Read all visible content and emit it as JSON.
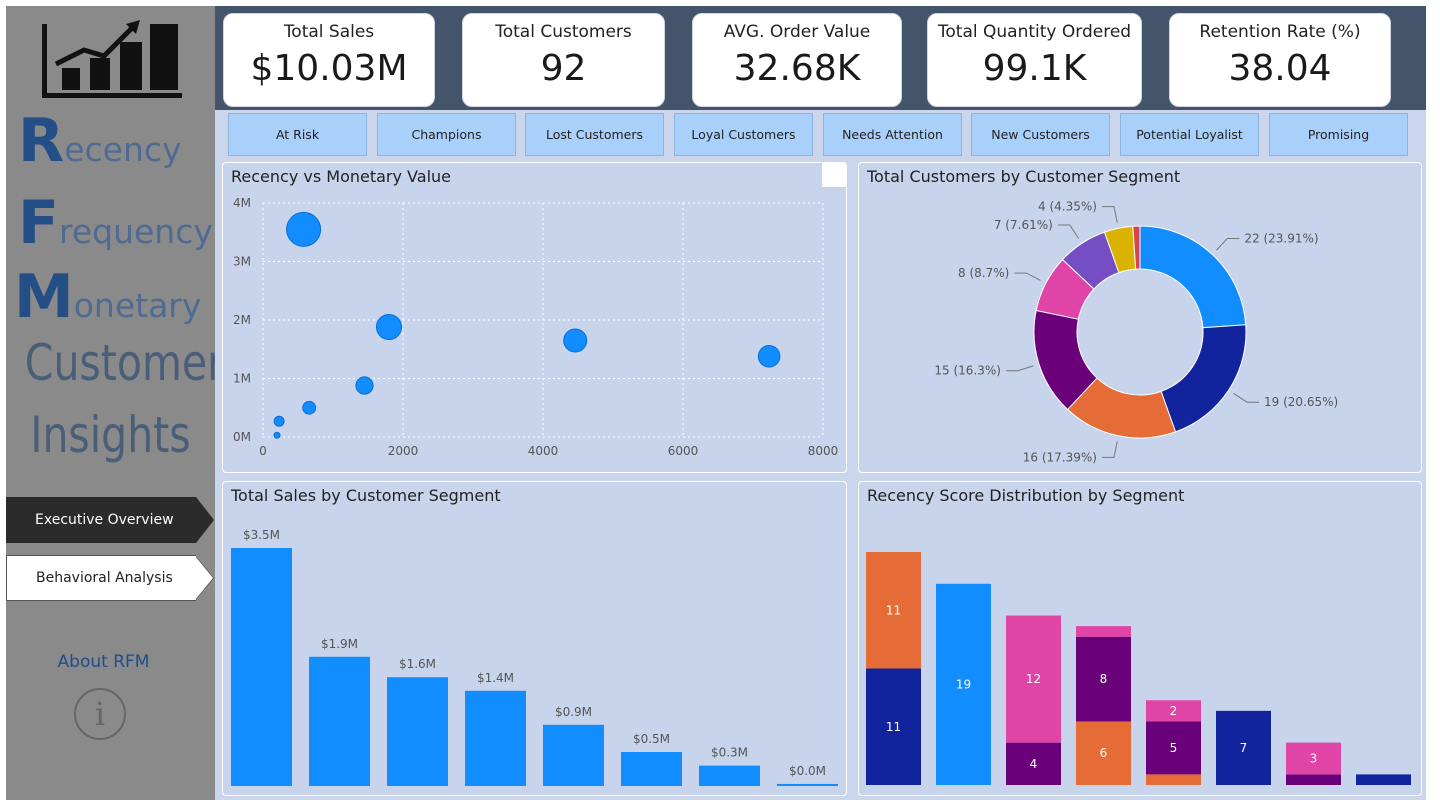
{
  "sidebar": {
    "rfm": [
      {
        "initial": "R",
        "rest": "ecency"
      },
      {
        "initial": "F",
        "rest": "requency"
      },
      {
        "initial": "M",
        "rest": "onetary"
      }
    ],
    "customer_text": "Customer",
    "insights_text": "Insights",
    "nav": [
      {
        "label": "Executive Overview",
        "active": true
      },
      {
        "label": "Behavioral Analysis",
        "active": false
      }
    ],
    "about_label": "About RFM",
    "about_icon": "i"
  },
  "kpis": [
    {
      "label": "Total Sales",
      "value": "$10.03M"
    },
    {
      "label": "Total Customers",
      "value": "92"
    },
    {
      "label": "AVG. Order Value",
      "value": "32.68K"
    },
    {
      "label": "Total Quantity Ordered",
      "value": "99.1K"
    },
    {
      "label": "Retention Rate (%)",
      "value": "38.04"
    }
  ],
  "segment_buttons": [
    "At Risk",
    "Champions",
    "Lost Customers",
    "Loyal Customers",
    "Needs Attention",
    "New Customers",
    "Potential Loyalist",
    "Promising"
  ],
  "panels": {
    "scatter_title": "Recency vs Monetary Value",
    "donut_title": "Total Customers by Customer Segment",
    "bar_title": "Total Sales by Customer Segment",
    "stack_title": "Recency Score Distribution by Segment"
  },
  "colors": {
    "bright_blue": "#118dff",
    "navy": "#12239e",
    "orange": "#e66c37",
    "dark_purple": "#6b007b",
    "pink": "#e044a7",
    "violet": "#744ec2",
    "gold": "#d9b300",
    "red": "#d64550"
  },
  "chart_data": [
    {
      "type": "scatter",
      "title": "Recency vs Monetary Value",
      "xlim": [
        0,
        8000
      ],
      "ylim": [
        0,
        4000000
      ],
      "x_ticks": [
        "0",
        "2000",
        "4000",
        "6000",
        "8000"
      ],
      "y_ticks": [
        "0M",
        "1M",
        "2M",
        "3M",
        "4M"
      ],
      "points": [
        {
          "x": 580,
          "y": 3550000,
          "size": 3.5
        },
        {
          "x": 1800,
          "y": 1880000,
          "size": 1.9
        },
        {
          "x": 4460,
          "y": 1650000,
          "size": 1.6
        },
        {
          "x": 7230,
          "y": 1380000,
          "size": 1.4
        },
        {
          "x": 1450,
          "y": 880000,
          "size": 0.9
        },
        {
          "x": 660,
          "y": 500000,
          "size": 0.5
        },
        {
          "x": 230,
          "y": 270000,
          "size": 0.3
        },
        {
          "x": 200,
          "y": 30000,
          "size": 0.03
        }
      ]
    },
    {
      "type": "pie",
      "title": "Total Customers by Customer Segment",
      "slices": [
        {
          "value": 22,
          "label": "22 (23.91%)",
          "color": "#118dff"
        },
        {
          "value": 19,
          "label": "19 (20.65%)",
          "color": "#12239e"
        },
        {
          "value": 16,
          "label": "16 (17.39%)",
          "color": "#e66c37"
        },
        {
          "value": 15,
          "label": "15 (16.3%)",
          "color": "#6b007b"
        },
        {
          "value": 8,
          "label": "8 (8.7%)",
          "color": "#e044a7"
        },
        {
          "value": 7,
          "label": "7 (7.61%)",
          "color": "#744ec2"
        },
        {
          "value": 4,
          "label": "4 (4.35%)",
          "color": "#d9b300"
        },
        {
          "value": 1,
          "label": "",
          "color": "#d64550"
        }
      ]
    },
    {
      "type": "bar",
      "title": "Total Sales by Customer Segment",
      "values": [
        3.5,
        1.9,
        1.6,
        1.4,
        0.9,
        0.5,
        0.3,
        0.03
      ],
      "labels": [
        "$3.5M",
        "$1.9M",
        "$1.6M",
        "$1.4M",
        "$0.9M",
        "$0.5M",
        "$0.3M",
        "$0.0M"
      ],
      "ylim": [
        0,
        3.5
      ]
    },
    {
      "type": "bar",
      "title": "Recency Score Distribution by Segment",
      "stacked": true,
      "ymax": 22,
      "columns": [
        [
          {
            "value": 11,
            "color": "#12239e",
            "label": "11"
          },
          {
            "value": 11,
            "color": "#e66c37",
            "label": "11"
          }
        ],
        [
          {
            "value": 19,
            "color": "#118dff",
            "label": "19"
          }
        ],
        [
          {
            "value": 4,
            "color": "#6b007b",
            "label": "4"
          },
          {
            "value": 12,
            "color": "#e044a7",
            "label": "12"
          }
        ],
        [
          {
            "value": 6,
            "color": "#e66c37",
            "label": "6"
          },
          {
            "value": 8,
            "color": "#6b007b",
            "label": "8"
          },
          {
            "value": 1,
            "color": "#e044a7",
            "label": ""
          }
        ],
        [
          {
            "value": 1,
            "color": "#e66c37",
            "label": ""
          },
          {
            "value": 5,
            "color": "#6b007b",
            "label": "5"
          },
          {
            "value": 2,
            "color": "#e044a7",
            "label": "2"
          }
        ],
        [
          {
            "value": 7,
            "color": "#12239e",
            "label": "7"
          }
        ],
        [
          {
            "value": 1,
            "color": "#6b007b",
            "label": ""
          },
          {
            "value": 3,
            "color": "#e044a7",
            "label": "3"
          }
        ],
        [
          {
            "value": 1,
            "color": "#12239e",
            "label": ""
          }
        ]
      ]
    }
  ]
}
